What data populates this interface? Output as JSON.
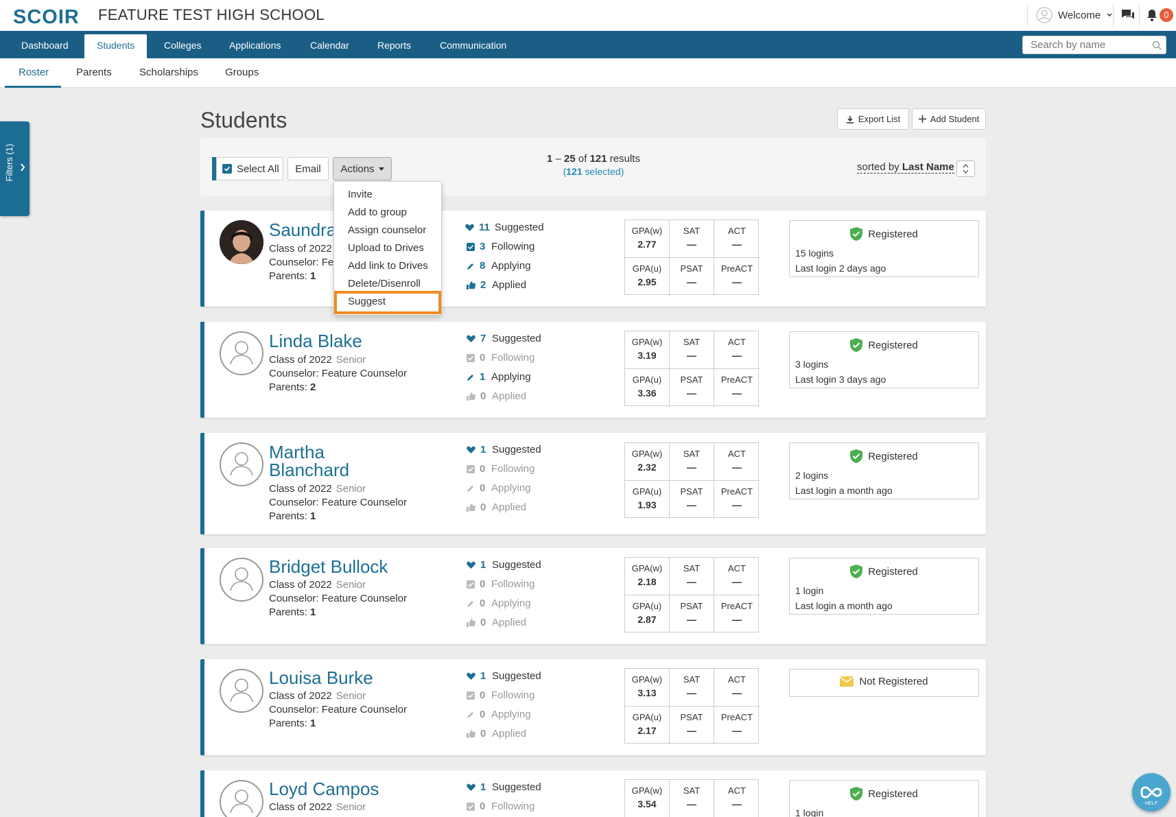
{
  "header": {
    "logo": "SCOIR",
    "school_name": "FEATURE TEST HIGH SCHOOL",
    "welcome": "Welcome",
    "notification_count": "0"
  },
  "nav": {
    "tabs": [
      "Dashboard",
      "Students",
      "Colleges",
      "Applications",
      "Calendar",
      "Reports",
      "Communication"
    ],
    "active": "Students",
    "search_placeholder": "Search by name"
  },
  "subnav": {
    "tabs": [
      "Roster",
      "Parents",
      "Scholarships",
      "Groups"
    ],
    "active": "Roster"
  },
  "filters": {
    "label": "Filters (1)"
  },
  "page": {
    "title": "Students",
    "export_label": "Export List",
    "add_label": "Add Student"
  },
  "toolbar": {
    "select_all": "Select All",
    "email": "Email",
    "actions": "Actions",
    "range_start": "1",
    "range_end": "25",
    "total": "121",
    "results_word": "results",
    "selected_count": "121",
    "selected_word": "selected",
    "sorted_by": "sorted by",
    "sort_field": "Last Name"
  },
  "actions_menu": [
    "Invite",
    "Add to group",
    "Assign counselor",
    "Upload to Drives",
    "Add link to Drives",
    "Delete/Disenroll",
    "Suggest"
  ],
  "labels": {
    "suggested": "Suggested",
    "following": "Following",
    "applying": "Applying",
    "applied": "Applied",
    "gpaw": "GPA(w)",
    "gpau": "GPA(u)",
    "sat": "SAT",
    "psat": "PSAT",
    "act": "ACT",
    "preact": "PreACT",
    "dash": "—",
    "parents": "Parents:",
    "class_of": "Class of 2022"
  },
  "colors": {
    "brand": "#1e6f93",
    "highlight": "#f18a21",
    "registered": "#4caf50",
    "not_registered": "#f0c94a"
  },
  "students": [
    {
      "name": "Saundra",
      "class": "Class of 2022",
      "grade": "",
      "counselor": "Counselor: Fea",
      "parents": "1",
      "suggested": "11",
      "following": "3",
      "applying": "8",
      "applied": "2",
      "gpaw": "2.77",
      "gpau": "2.95",
      "status": "Registered",
      "logins": "15 logins",
      "last_login": "Last login 2 days ago"
    },
    {
      "name": "Linda Blake",
      "class": "Class of 2022",
      "grade": "Senior",
      "counselor": "Counselor: Feature Counselor",
      "parents": "2",
      "suggested": "7",
      "following": "0",
      "applying": "1",
      "applied": "0",
      "gpaw": "3.19",
      "gpau": "3.36",
      "status": "Registered",
      "logins": "3 logins",
      "last_login": "Last login 3 days ago"
    },
    {
      "name_line1": "Martha",
      "name_line2": "Blanchard",
      "class": "Class of 2022",
      "grade": "Senior",
      "counselor": "Counselor: Feature Counselor",
      "parents": "1",
      "suggested": "1",
      "following": "0",
      "applying": "0",
      "applied": "0",
      "gpaw": "2.32",
      "gpau": "1.93",
      "status": "Registered",
      "logins": "2 logins",
      "last_login": "Last login a month ago"
    },
    {
      "name": "Bridget Bullock",
      "class": "Class of 2022",
      "grade": "Senior",
      "counselor": "Counselor: Feature Counselor",
      "parents": "1",
      "suggested": "1",
      "following": "0",
      "applying": "0",
      "applied": "0",
      "gpaw": "2.18",
      "gpau": "2.87",
      "status": "Registered",
      "logins": "1 login",
      "last_login": "Last login a month ago"
    },
    {
      "name": "Louisa Burke",
      "class": "Class of 2022",
      "grade": "Senior",
      "counselor": "Counselor: Feature Counselor",
      "parents": "1",
      "suggested": "1",
      "following": "0",
      "applying": "0",
      "applied": "0",
      "gpaw": "3.13",
      "gpau": "2.17",
      "status": "Not Registered"
    },
    {
      "name": "Loyd Campos",
      "class": "Class of 2022",
      "grade": "Senior",
      "suggested": "1",
      "following": "0",
      "gpaw": "3.54",
      "status": "Registered",
      "logins": "1 login"
    }
  ],
  "help": {
    "label": "HELP"
  }
}
